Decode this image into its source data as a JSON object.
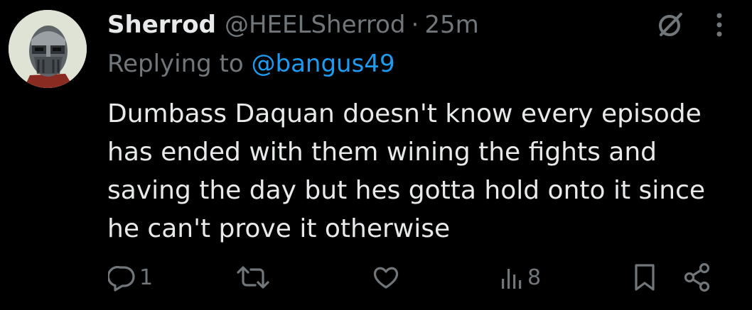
{
  "post": {
    "author_name": "Sherrod",
    "author_handle": "@HEELSherrod",
    "separator": "·",
    "time": "25m",
    "replying_label": "Replying to",
    "replying_handle": "@bangus49",
    "text_lines": [
      "Dumbass Daquan doesn't know every episode",
      "has ended with them wining the fights and",
      "saving the day but hes gotta hold onto it since",
      "he can't prove it otherwise"
    ]
  },
  "actions": {
    "reply_count": "1",
    "repost_count": "",
    "like_count": "",
    "views_count": "8"
  },
  "icons": {
    "top": [
      "grok-icon",
      "more-options-icon"
    ],
    "actions": [
      "reply-icon",
      "repost-icon",
      "like-icon",
      "views-icon",
      "bookmark-icon",
      "share-icon"
    ]
  },
  "colors": {
    "background": "#000000",
    "text_primary": "#e7e9ea",
    "text_secondary": "#71767b",
    "link": "#1d9bf0"
  }
}
